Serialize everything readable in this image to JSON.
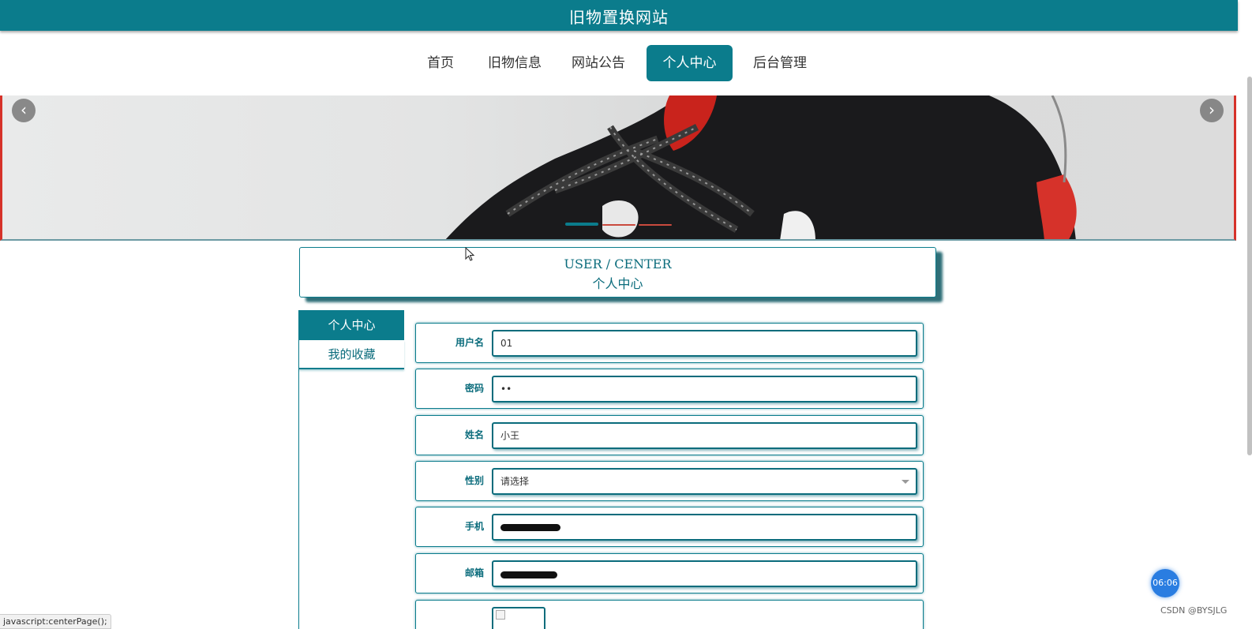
{
  "site": {
    "title": "旧物置换网站"
  },
  "nav": {
    "items": [
      {
        "label": "首页"
      },
      {
        "label": "旧物信息"
      },
      {
        "label": "网站公告"
      },
      {
        "label": "个人中心"
      },
      {
        "label": "后台管理"
      }
    ],
    "active": "个人中心"
  },
  "banner": {
    "prev_icon": "chevron-left-icon",
    "next_icon": "chevron-right-icon",
    "slide_count": 3,
    "active_slide": 1
  },
  "section": {
    "title_en": "USER / CENTER",
    "title_zh": "个人中心"
  },
  "sidebar": {
    "items": [
      {
        "label": "个人中心"
      },
      {
        "label": "我的收藏"
      }
    ]
  },
  "form": {
    "username": {
      "label": "用户名",
      "value": "01"
    },
    "password": {
      "label": "密码",
      "value": "••"
    },
    "name": {
      "label": "姓名",
      "value": "小王"
    },
    "gender": {
      "label": "性别",
      "value": "请选择"
    },
    "phone": {
      "label": "手机"
    },
    "email": {
      "label": "邮箱"
    }
  },
  "overlay": {
    "timer": "06:06",
    "watermark": "CSDN @BYSJLG",
    "status_url": "javascript:centerPage();"
  },
  "colors": {
    "primary": "#0b7c8c",
    "accent": "#d6322a",
    "timer": "#2a7de1"
  }
}
